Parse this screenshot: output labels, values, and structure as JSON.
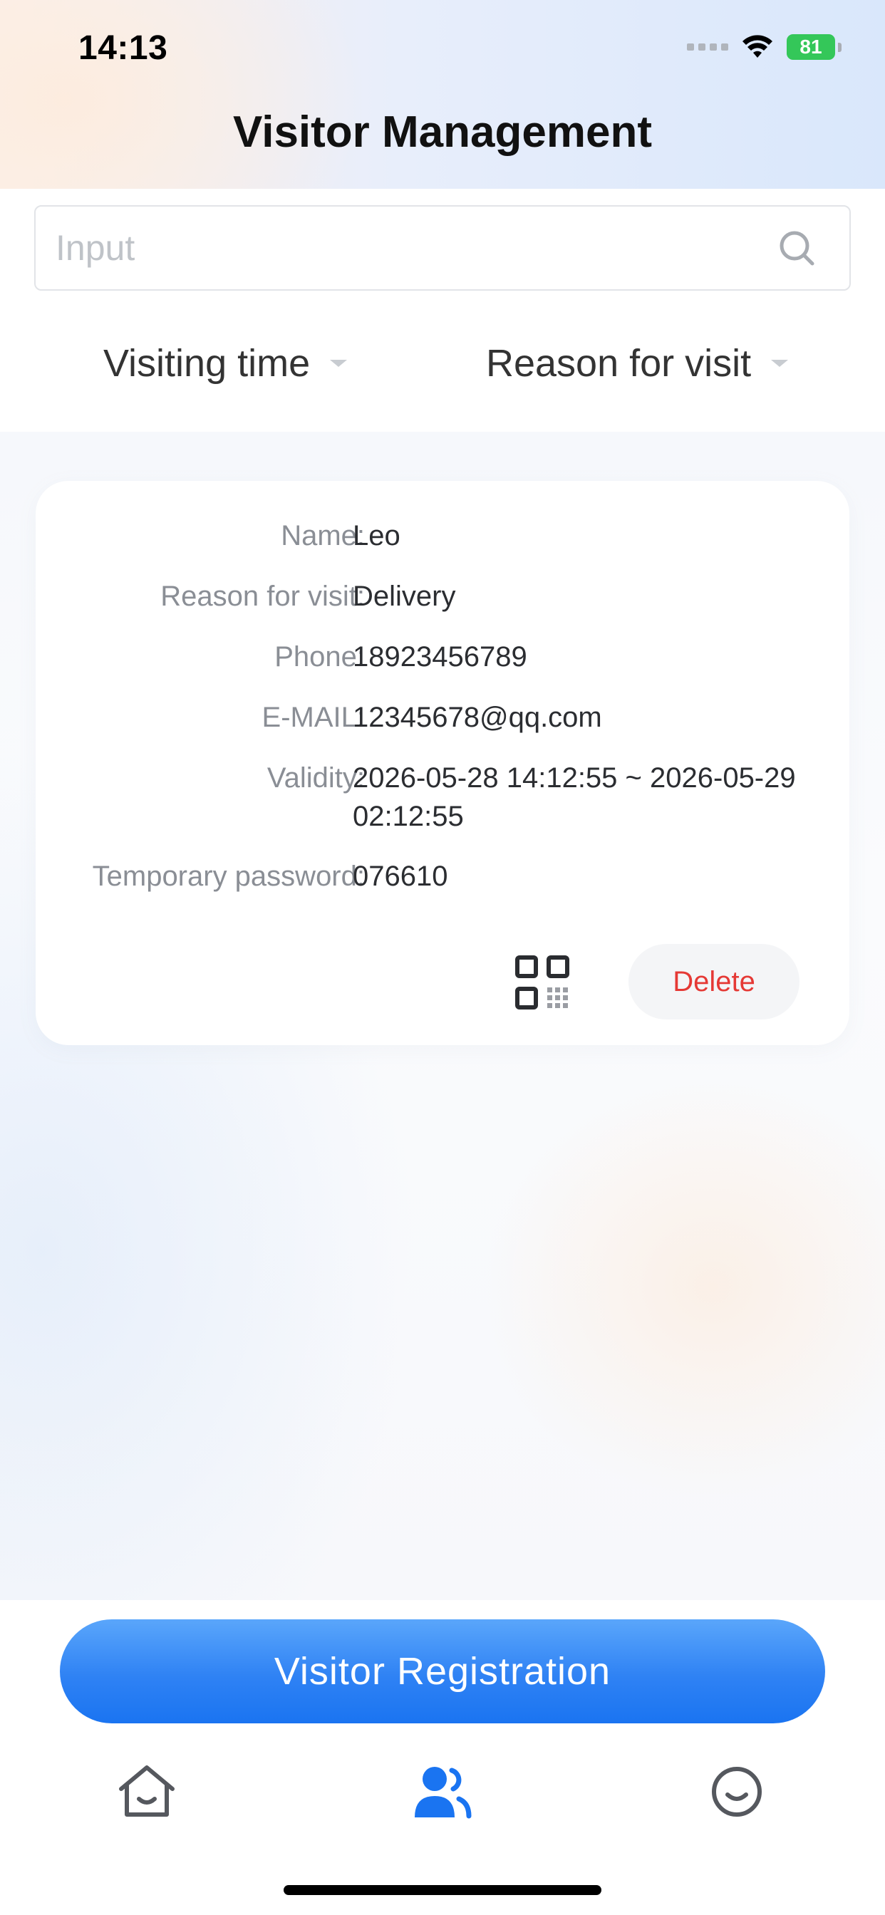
{
  "status_bar": {
    "time": "14:13",
    "battery": "81"
  },
  "header": {
    "title": "Visitor Management"
  },
  "search": {
    "placeholder": "Input",
    "value": ""
  },
  "filters": {
    "visiting_time": "Visiting time",
    "reason_for_visit": "Reason for visit"
  },
  "visitors": [
    {
      "name_label": "Name:",
      "name": "Leo",
      "reason_label": "Reason for visit:",
      "reason": "Delivery",
      "phone_label": "Phone:",
      "phone": "18923456789",
      "email_label": "E-MAIL:",
      "email": "12345678@qq.com",
      "validity_label": "Validity:",
      "validity_line1": "2026-05-28 14:12:55 ~ 2026-05-29",
      "validity_line2": "02:12:55",
      "password_label": "Temporary password:",
      "password": "076610",
      "delete_label": "Delete"
    }
  ],
  "actions": {
    "register_label": "Visitor Registration"
  },
  "tab_bar": {
    "items": [
      {
        "icon": "home-icon",
        "active": false
      },
      {
        "icon": "visitors-icon",
        "active": true
      },
      {
        "icon": "profile-icon",
        "active": false
      }
    ]
  },
  "colors": {
    "accent": "#1a74f1",
    "delete": "#e53935",
    "battery": "#34c759"
  }
}
